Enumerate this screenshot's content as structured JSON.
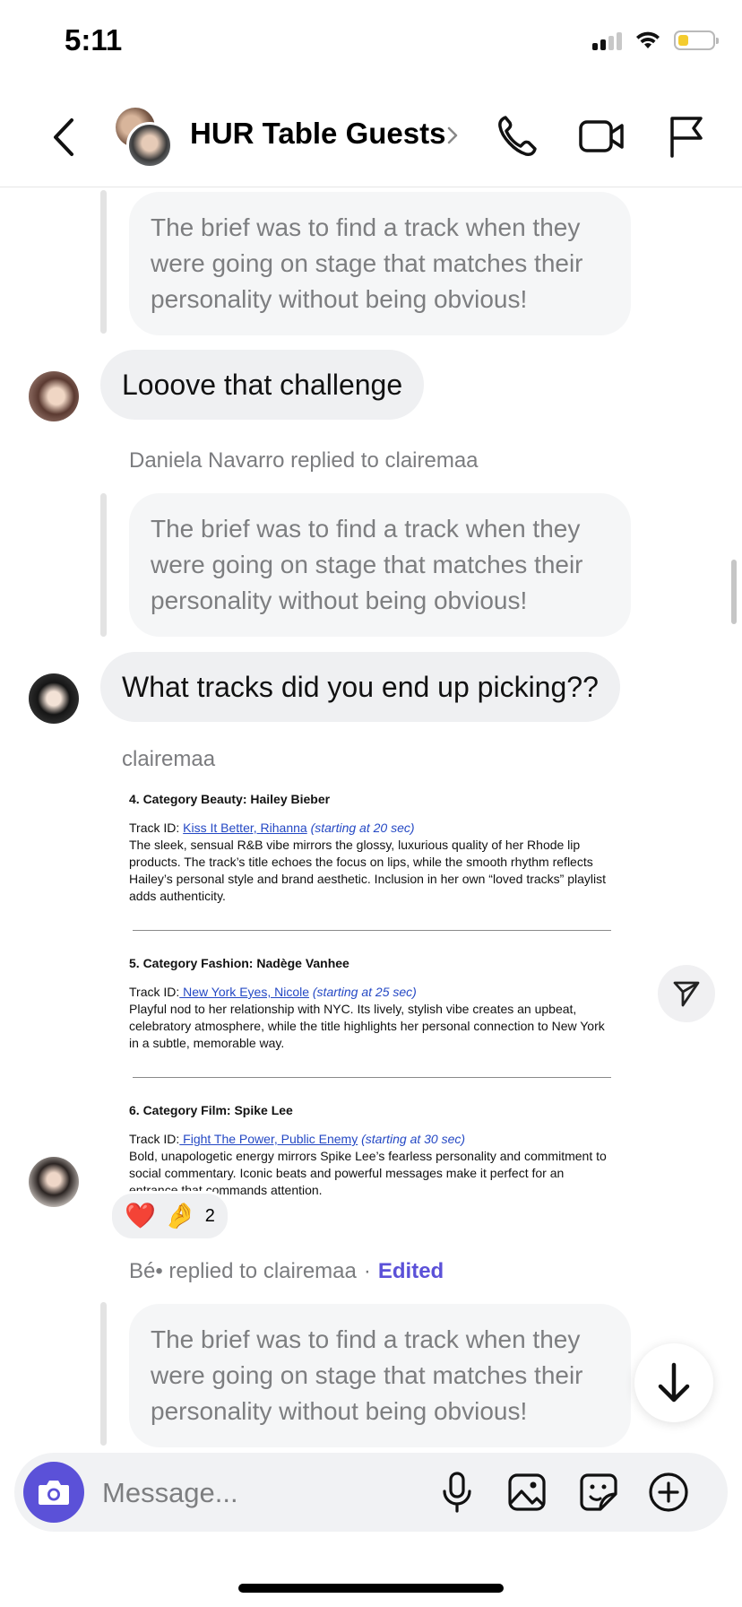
{
  "status_bar": {
    "time": "5:11"
  },
  "header": {
    "title": "HUR Table Guests"
  },
  "quoted_text": "The brief was to find a track when they were going on stage that matches their personality without being obvious!",
  "messages": {
    "m1_text": "Looove that challenge",
    "m2_meta": "Daniela Navarro replied to clairemaa",
    "m2_text": "What tracks did you end up picking??",
    "m3_sender": "clairemaa",
    "m4_meta_prefix": "Bé• replied to clairemaa",
    "m4_meta_sep": "·",
    "m4_meta_edited": "Edited"
  },
  "document": {
    "sections": [
      {
        "heading": "4. Category Beauty: Hailey Bieber",
        "track_label": "Track ID: ",
        "track_link": "Kiss It Better, Rihanna",
        "track_time": " (starting at 20 sec)",
        "body": "The sleek, sensual R&B vibe mirrors the glossy, luxurious quality of her Rhode lip products. The track’s title echoes the focus on lips, while the smooth rhythm reflects Hailey’s personal style and brand aesthetic. Inclusion in her own “loved tracks” playlist adds authenticity."
      },
      {
        "heading": "5. Category Fashion: Nadège Vanhee",
        "track_label": "Track ID:",
        "track_link": " New York Eyes, Nicole",
        "track_time": " (starting at 25 sec)",
        "body": "Playful nod to her relationship with NYC. Its lively, stylish vibe creates an upbeat, celebratory atmosphere, while the title highlights her personal connection to New York in a subtle, memorable way."
      },
      {
        "heading": "6. Category Film: Spike Lee",
        "track_label": "Track ID:",
        "track_link": " Fight The Power, Public Enemy",
        "track_time": " (starting at 30 sec)",
        "body": "Bold, unapologetic energy mirrors Spike Lee’s fearless personality and commitment to social commentary. Iconic beats and powerful messages make it perfect for an entrance that commands attention."
      }
    ]
  },
  "reactions": {
    "emoji_1": "❤️",
    "emoji_2": "🤌",
    "count": "2"
  },
  "composer": {
    "placeholder": "Message..."
  },
  "icons": [
    "back-chevron-icon",
    "chevron-right-icon",
    "phone-icon",
    "video-camera-icon",
    "flag-icon",
    "share-send-icon",
    "arrow-down-icon",
    "camera-icon",
    "microphone-icon",
    "image-icon",
    "sticker-icon",
    "plus-circle-icon"
  ],
  "colors": {
    "accent": "#5b51d8",
    "bubble": "#eff0f2",
    "quote_bg": "#f5f6f7",
    "link": "#2448c4"
  }
}
